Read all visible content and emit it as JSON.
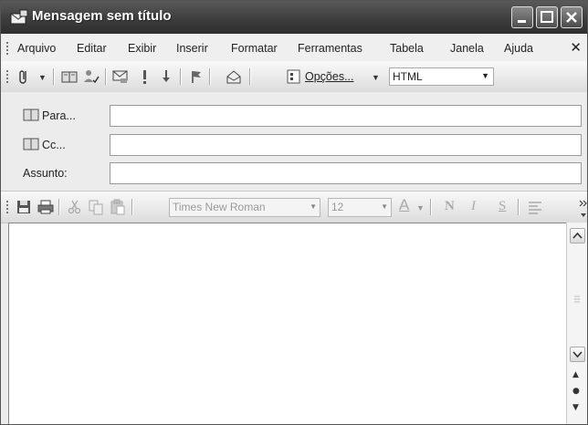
{
  "window": {
    "title": "Mensagem sem título"
  },
  "menu": {
    "items": [
      "Arquivo",
      "Editar",
      "Exibir",
      "Inserir",
      "Formatar",
      "Ferramentas",
      "Tabela",
      "Janela",
      "Ajuda"
    ]
  },
  "toolbar": {
    "options_label": "Opções...",
    "format_value": "HTML"
  },
  "address": {
    "to_label": "Para...",
    "cc_label": "Cc...",
    "subject_label": "Assunto:",
    "to_value": "",
    "cc_value": "",
    "subject_value": ""
  },
  "format_bar": {
    "font_name": "Times New Roman",
    "font_size": "12",
    "bold": "N",
    "italic": "I",
    "underline": "S"
  },
  "body": {
    "text": ""
  }
}
